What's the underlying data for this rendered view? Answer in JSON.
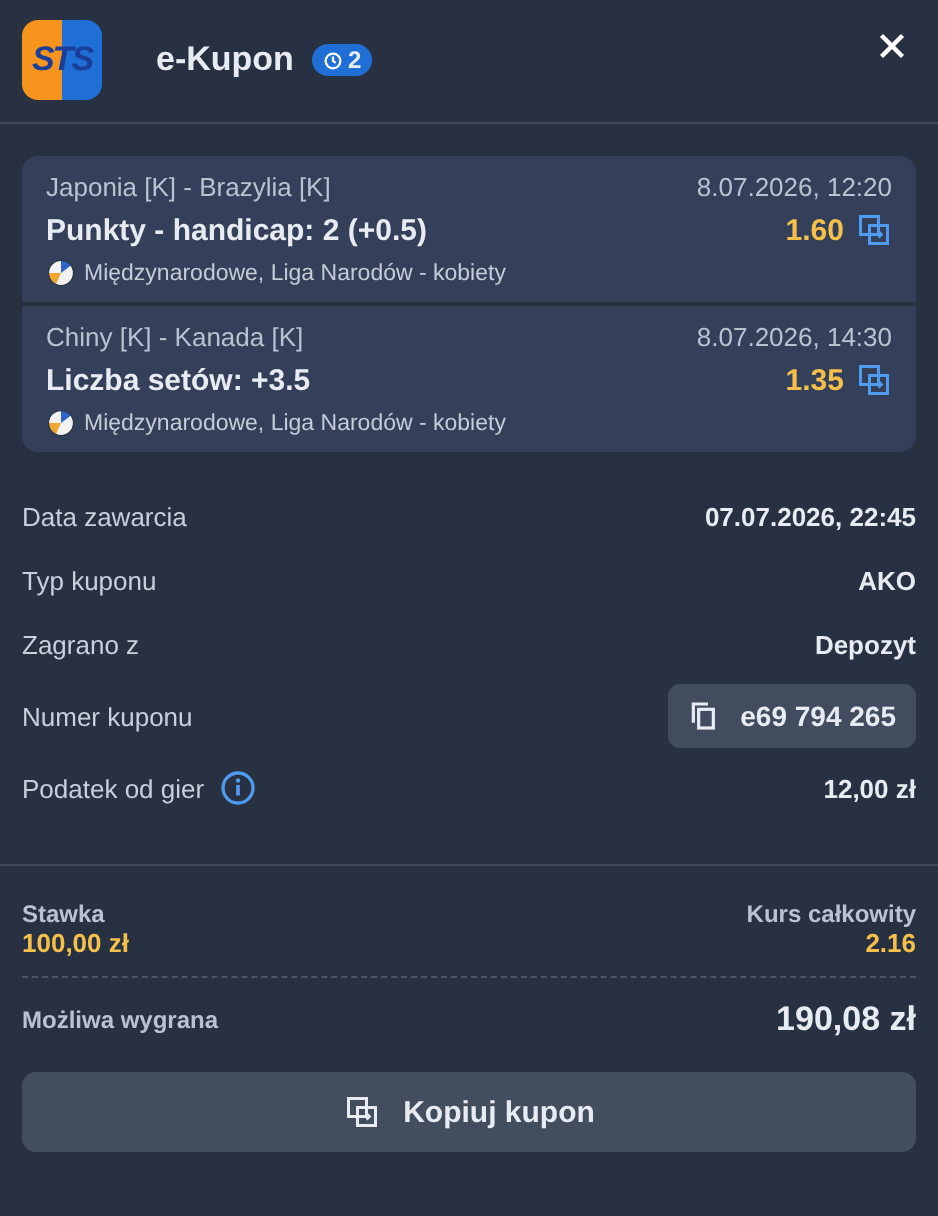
{
  "header": {
    "logo": "STS",
    "title": "e-Kupon",
    "badge": "2"
  },
  "bets": [
    {
      "match": "Japonia [K] - Brazylia [K]",
      "datetime": "8.07.2026, 12:20",
      "market": "Punkty - handicap: 2 (+0.5)",
      "odds": "1.60",
      "league": "Międzynarodowe, Liga Narodów - kobiety"
    },
    {
      "match": "Chiny [K] - Kanada [K]",
      "datetime": "8.07.2026, 14:30",
      "market": "Liczba setów: +3.5",
      "odds": "1.35",
      "league": "Międzynarodowe, Liga Narodów - kobiety"
    }
  ],
  "details": [
    {
      "kind": "plain",
      "label": "Data zawarcia",
      "value": "07.07.2026, 22:45"
    },
    {
      "kind": "plain",
      "label": "Typ kuponu",
      "value": "AKO"
    },
    {
      "kind": "plain",
      "label": "Zagrano z",
      "value": "Depozyt"
    },
    {
      "kind": "copy",
      "label": "Numer kuponu",
      "value": "e69 794 265"
    },
    {
      "kind": "info",
      "label": "Podatek od gier",
      "value": "12,00 zł"
    }
  ],
  "summary": {
    "stake_label": "Stawka",
    "stake": "100,00 zł",
    "odds_label": "Kurs całkowity",
    "odds": "2.16",
    "win_label": "Możliwa wygrana",
    "win": "190,08 zł"
  },
  "button": "Kopiuj kupon"
}
